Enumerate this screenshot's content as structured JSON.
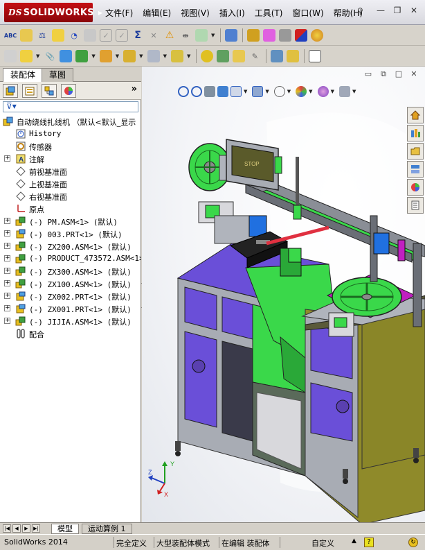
{
  "app": {
    "brand": "SOLIDWORKS",
    "brand_prefix": "DS",
    "menus": [
      "文件(F)",
      "编辑(E)",
      "视图(V)",
      "插入(I)",
      "工具(T)",
      "窗口(W)",
      "帮助(H)"
    ],
    "window_controls": [
      "minimize-icon",
      "restore-icon",
      "close-icon"
    ]
  },
  "toolbar1_icons": [
    "spell-check-icon",
    "measure-icon",
    "mass-properties-icon",
    "section-properties-icon",
    "performance-eval-icon",
    "hole-align-icon",
    "check-icon",
    "check-icon",
    "sum-equations-icon",
    "interference-icon",
    "warning-icon",
    "align-icon",
    "rebuild-icon",
    "toggle-icon",
    "table-icon",
    "color-icon",
    "appearance-icon",
    "render-icon"
  ],
  "toolbar2_icons": [
    "insert-component-icon",
    "new-part-icon",
    "mate-icon",
    "linear-pattern-icon",
    "smart-fasteners-icon",
    "move-component-icon",
    "exploded-view-icon",
    "assembly-features-icon",
    "reference-geometry-icon",
    "configurations-icon",
    "bom-icon",
    "settings-icon",
    "sketch-icon",
    "drawing-icon",
    "note-icon",
    "view-icon"
  ],
  "panel": {
    "tabs": [
      "装配体",
      "草图"
    ],
    "active_tab": "装配体",
    "expand_label": "»",
    "manager_icons": [
      "feature-manager-icon",
      "property-manager-icon",
      "configuration-manager-icon",
      "display-manager-icon"
    ],
    "filter_icon": "filter-icon"
  },
  "tree": [
    {
      "label": "自动绕线扎线机 （默认<默认_显示",
      "icon": "assembly-icon",
      "level": 0,
      "expander": ""
    },
    {
      "label": "History",
      "icon": "history-icon",
      "level": 1,
      "expander": ""
    },
    {
      "label": "传感器",
      "icon": "sensor-icon",
      "level": 1,
      "expander": ""
    },
    {
      "label": "注解",
      "icon": "annotation-icon",
      "level": 1,
      "expander": "+"
    },
    {
      "label": "前视基准面",
      "icon": "plane-icon",
      "level": 1,
      "expander": ""
    },
    {
      "label": "上视基准面",
      "icon": "plane-icon",
      "level": 1,
      "expander": ""
    },
    {
      "label": "右视基准面",
      "icon": "plane-icon",
      "level": 1,
      "expander": ""
    },
    {
      "label": "原点",
      "icon": "origin-icon",
      "level": 1,
      "expander": ""
    },
    {
      "label": "(-) PM.ASM<1> (默认)",
      "icon": "subassembly-icon",
      "level": 1,
      "expander": "+"
    },
    {
      "label": "(-) 003.PRT<1> (默认)",
      "icon": "part-icon",
      "level": 1,
      "expander": "+"
    },
    {
      "label": "(-) ZX200.ASM<1> (默认)",
      "icon": "subassembly-icon",
      "level": 1,
      "expander": "+"
    },
    {
      "label": "(-) PRODUCT_473572.ASM<1>",
      "icon": "subassembly-icon",
      "level": 1,
      "expander": "+"
    },
    {
      "label": "(-) ZX300.ASM<1> (默认)",
      "icon": "subassembly-icon",
      "level": 1,
      "expander": "+"
    },
    {
      "label": "(-) ZX100.ASM<1> (默认)",
      "icon": "subassembly-icon",
      "level": 1,
      "expander": "+"
    },
    {
      "label": "(-) ZX002.PRT<1> (默认)",
      "icon": "part-icon",
      "level": 1,
      "expander": "+"
    },
    {
      "label": "(-) ZX001.PRT<1> (默认)",
      "icon": "part-icon",
      "level": 1,
      "expander": "+"
    },
    {
      "label": "(-) JIJIA.ASM<1> (默认)",
      "icon": "subassembly-icon",
      "level": 1,
      "expander": "+"
    },
    {
      "label": "配合",
      "icon": "mates-icon",
      "level": 1,
      "expander": ""
    }
  ],
  "bottom_tabs": [
    "模型",
    "运动算例 1"
  ],
  "status": {
    "app_version": "SolidWorks 2014",
    "definition": "完全定义",
    "mode": "大型装配体模式",
    "editing": "在编辑 装配体",
    "units": "自定义"
  },
  "viewport": {
    "screen_text": "STOP",
    "triad_axes": [
      "X",
      "Y",
      "Z"
    ],
    "view_controls": [
      "restore-icon",
      "tile-icon",
      "maximize-icon",
      "close-icon"
    ],
    "headsup_icons": [
      "zoom-to-fit-icon",
      "zoom-area-icon",
      "previous-view-icon",
      "section-view-icon",
      "view-orientation-icon",
      "display-style-icon",
      "hide-show-icon",
      "edit-appearance-icon",
      "apply-scene-icon",
      "view-settings-icon"
    ],
    "taskpane_icons": [
      "home-icon",
      "design-library-icon",
      "file-explorer-icon",
      "view-palette-icon",
      "appearances-icon",
      "custom-properties-icon"
    ]
  },
  "colors": {
    "accent": "#c40f14",
    "viewport_bg": "#f4f5f8",
    "machine_purple": "#6a4fd8",
    "machine_green": "#3ad84a",
    "machine_olive": "#8f8a2a",
    "frame_gray": "#b0b4bc",
    "magenta": "#c020c0"
  }
}
